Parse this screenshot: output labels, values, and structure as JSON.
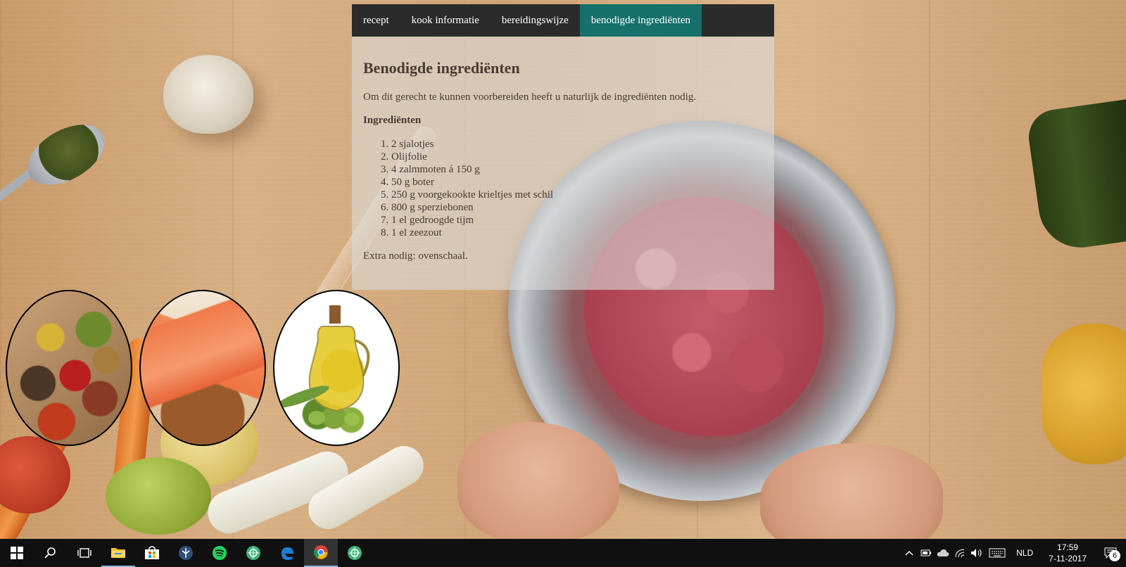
{
  "nav": {
    "items": [
      {
        "label": "recept",
        "active": false
      },
      {
        "label": "kook informatie",
        "active": false
      },
      {
        "label": "bereidingswijze",
        "active": false
      },
      {
        "label": "benodigde ingrediënten",
        "active": true
      }
    ]
  },
  "content": {
    "title": "Benodigde ingrediënten",
    "intro": "Om dit gerecht te kunnen voorbereiden heeft u naturlijk de ingrediënten nodig.",
    "subheading": "Ingrediënten",
    "ingredients": [
      "2 sjalotjes",
      "Olijfolie",
      "4 zalmmoten á 150 g",
      "50 g boter",
      "250 g voorgekookte krieltjes met schil",
      "800 g sperziebonen",
      "1 el gedroogde tijm",
      "1 el zeezout"
    ],
    "extra": "Extra nodig: ovenschaal."
  },
  "images": [
    {
      "icon": "spices-photo"
    },
    {
      "icon": "salmon-photo"
    },
    {
      "icon": "olive-oil-photo"
    }
  ],
  "taskbar": {
    "apps": [
      "windows-start-icon",
      "search-icon",
      "task-view-icon",
      "file-explorer-icon",
      "store-icon",
      "app-icon",
      "spotify-icon",
      "app-icon",
      "edge-icon",
      "chrome-icon",
      "app-icon"
    ],
    "language": "NLD",
    "time": "17:59",
    "date": "7-11-2017",
    "notification_count": "6"
  },
  "colors": {
    "nav_bg": "#2b2b2b",
    "nav_active": "#16706b",
    "panel_text": "#4a3a33",
    "taskbar_bg": "#101010"
  }
}
